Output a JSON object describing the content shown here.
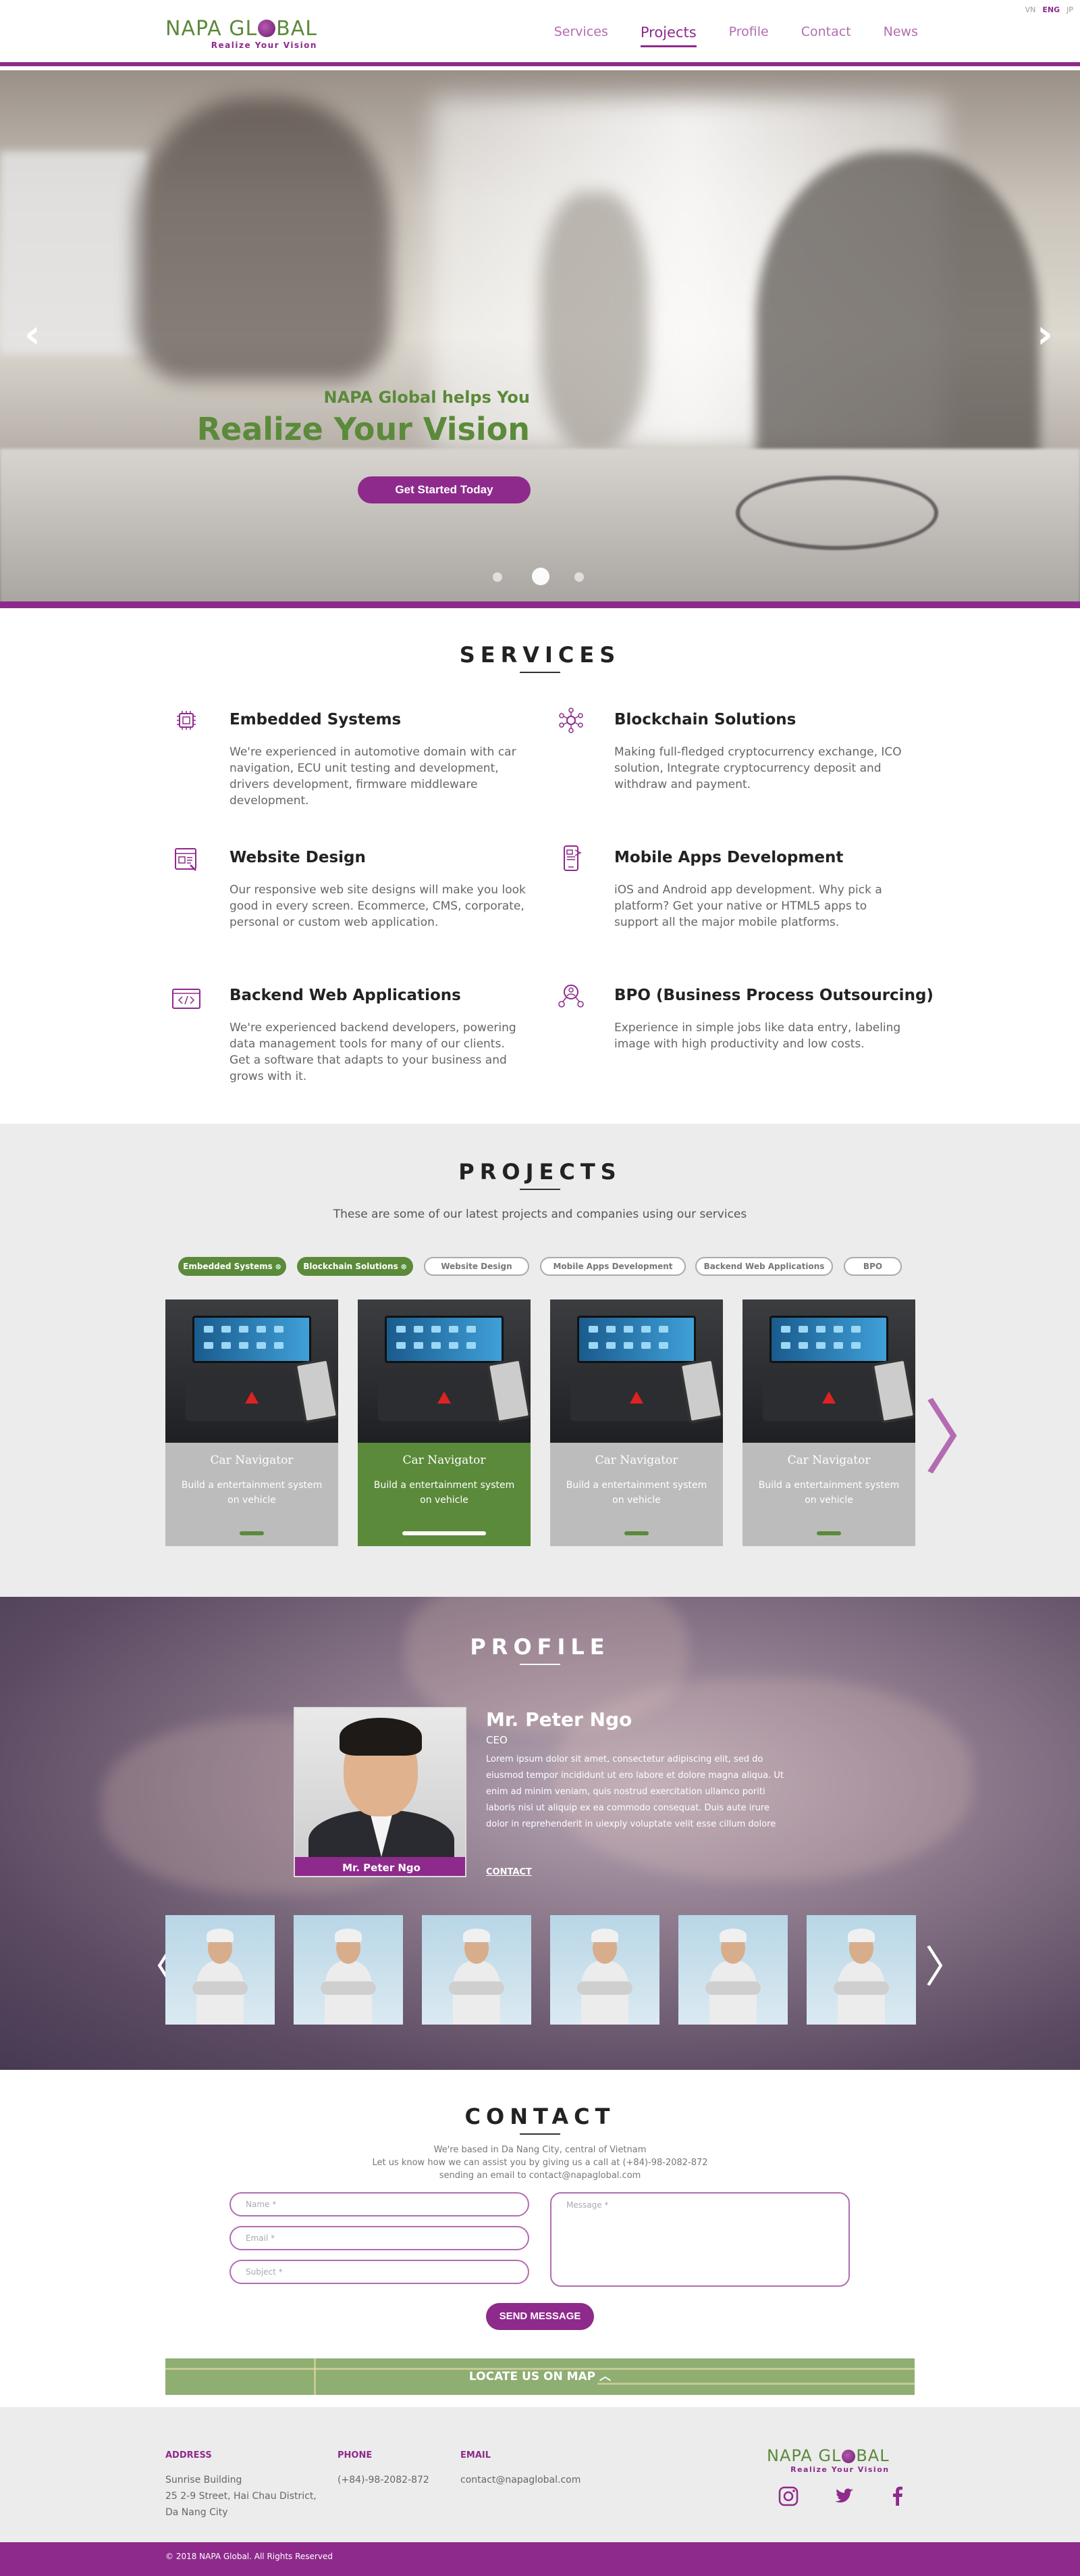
{
  "header": {
    "logo_text_left": "NAPA GL",
    "logo_text_right": "BAL",
    "tagline": "Realize Your Vision",
    "nav": [
      {
        "label": "Services"
      },
      {
        "label": "Projects"
      },
      {
        "label": "Profile"
      },
      {
        "label": "Contact"
      },
      {
        "label": "News"
      }
    ],
    "lang": [
      "VN",
      "ENG",
      "JP"
    ]
  },
  "hero": {
    "subtitle": "NAPA Global helps You",
    "title": "Realize Your Vision",
    "cta": "Get Started Today",
    "prev_icon": "‹",
    "next_icon": "›",
    "slides": 3,
    "active_slide": 2
  },
  "services": {
    "title": "SERVICES",
    "items": [
      {
        "icon": "chip-icon",
        "title": "Embedded Systems",
        "desc": "We're experienced in automotive domain with car navigation, ECU unit testing and development, drivers development, firmware middleware development."
      },
      {
        "icon": "blockchain-icon",
        "title": "Blockchain Solutions",
        "desc": "Making full-fledged cryptocurrency exchange, ICO solution, Integrate cryptocurrency deposit and withdraw and payment."
      },
      {
        "icon": "web-design-icon",
        "title": "Website Design",
        "desc": "Our responsive web site designs will make you look good in every screen. Ecommerce, CMS, corporate, personal or custom web application."
      },
      {
        "icon": "mobile-icon",
        "title": "Mobile Apps Development",
        "desc": "iOS and Android app development. Why pick a platform? Get your native or HTML5 apps to support all the major mobile platforms."
      },
      {
        "icon": "code-window-icon",
        "title": "Backend Web Applications",
        "desc": "We're experienced backend developers, powering data management tools for many of our clients. Get a software that adapts to your business and grows with it."
      },
      {
        "icon": "bpo-icon",
        "title": "BPO (Business Process Outsourcing)",
        "desc": "Experience in simple jobs like data entry, labeling image with high productivity and low costs."
      }
    ]
  },
  "projects": {
    "title": "PROJECTS",
    "subtitle": "These are some of our latest projects and companies using our services",
    "filters": [
      {
        "label": "Embedded Systems",
        "active": true
      },
      {
        "label": "Blockchain Solutions",
        "active": true
      },
      {
        "label": "Website Design",
        "active": false
      },
      {
        "label": "Mobile Apps Development",
        "active": false
      },
      {
        "label": "Backend Web Applications",
        "active": false
      },
      {
        "label": "BPO",
        "active": false
      }
    ],
    "cards": [
      {
        "name": "Car Navigator",
        "desc": "Build a entertainment system on vehicle",
        "active": false
      },
      {
        "name": "Car Navigator",
        "desc": "Build a entertainment system on vehicle",
        "active": true
      },
      {
        "name": "Car Navigator",
        "desc": "Build a entertainment system on vehicle",
        "active": false
      },
      {
        "name": "Car Navigator",
        "desc": "Build a entertainment system on vehicle",
        "active": false
      }
    ],
    "prev_icon": "〈",
    "next_icon": "〉"
  },
  "profile": {
    "title": "PROFILE",
    "name": "Mr. Peter Ngo",
    "photo_caption": "Mr. Peter Ngo",
    "role": "CEO",
    "bio": "Lorem ipsum dolor sit amet, consectetur adipiscing elit, sed do eiusmod tempor incididunt ut ero labore et dolore magna aliqua. Ut enim ad minim veniam, quis nostrud exercitation ullamco poriti laboris nisi ut aliquip ex ea commodo consequat. Duis aute irure dolor in reprehenderit in uiexply voluptate velit esse cillum dolore",
    "contact_link": "CONTACT",
    "thumbs": 6,
    "prev_icon": "〈",
    "next_icon": "〉"
  },
  "contact": {
    "title": "CONTACT",
    "info": [
      "We're based in Da Nang City, central of Vietnam",
      "Let us know how we can assist you by giving us a call at (+84)-98-2082-872",
      "sending an email to contact@napaglobal.com"
    ],
    "name_placeholder": "Name *",
    "email_placeholder": "Email *",
    "subject_placeholder": "Subject *",
    "message_placeholder": "Message *",
    "send": "SEND MESSAGE",
    "map": "LOCATE US ON MAP ︿"
  },
  "footer": {
    "address_label": "ADDRESS",
    "address_lines": [
      "Sunrise Building",
      "25 2-9 Street, Hai Chau District,",
      "Da Nang City"
    ],
    "phone_label": "PHONE",
    "phone": "(+84)-98-2082-872",
    "email_label": "EMAIL",
    "email": "contact@napaglobal.com",
    "copyright": "© 2018 NAPA Global. All Rights Reserved"
  },
  "colors": {
    "purple": "#8e2a8c",
    "green": "#5b8a3a",
    "grey": "#ececec"
  }
}
